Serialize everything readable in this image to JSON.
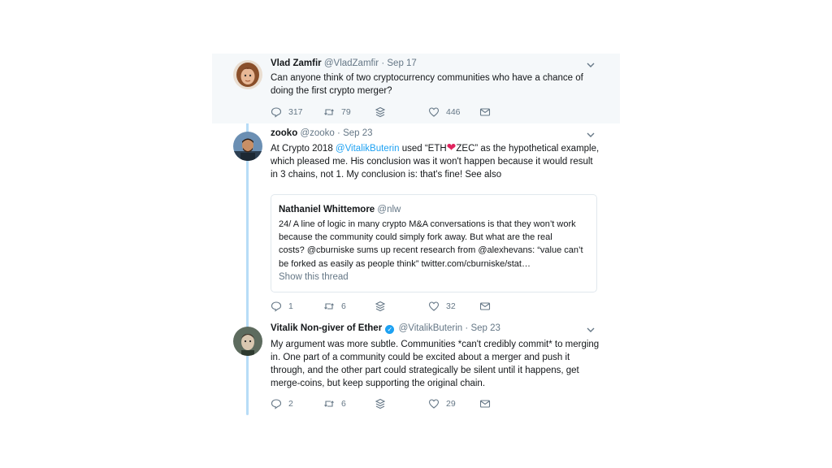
{
  "tweets": [
    {
      "name": "Vlad Zamfir",
      "handle": "@VladZamfir",
      "date": "Sep 17",
      "text_lines": [
        "Can anyone think of two cryptocurrency communities who have a chance of",
        "doing the first crypto merger?"
      ],
      "replies": "317",
      "retweets": "79",
      "likes": "446"
    },
    {
      "name": "zooko",
      "handle": "@zooko",
      "date": "Sep 23",
      "line1_before": "At Crypto 2018 ",
      "line1_mention": "@VitalikButerin",
      "line1_mid": " used “ETH",
      "line1_heart": "❤",
      "line1_after": "ZEC” as the hypothetical example,",
      "line2": "which pleased me. His conclusion was it won't happen because it would result",
      "line3": "in 3 chains, not 1. My conclusion is: that's fine! See also",
      "quote": {
        "name": "Nathaniel Whittemore",
        "handle": "@nlw",
        "lines": [
          "24/ A line of logic in many crypto M&A conversations is that they won’t work",
          "because the community could simply fork away. But what are the real",
          "costs? @cburniske sums up recent research from @alexhevans: “value can’t",
          "be forked as easily as people think” twitter.com/cburniske/stat…"
        ],
        "show_thread": "Show this thread"
      },
      "replies": "1",
      "retweets": "6",
      "likes": "32"
    },
    {
      "name": "Vitalik Non-giver of Ether",
      "verified_icon": "✓",
      "handle": "@VitalikButerin",
      "date": "Sep 23",
      "text_lines": [
        "My argument was more subtle. Communities *can't credibly commit* to merging",
        "in. One part of a community could be excited about a merger and push it",
        "through, and the other part could strategically be silent until it happens, get",
        "merge-coins, but keep supporting the original chain."
      ],
      "replies": "2",
      "retweets": "6",
      "likes": "29"
    }
  ],
  "separator": "·",
  "icons": [
    "chevron-down-icon",
    "reply-icon",
    "retweet-icon",
    "stack-icon",
    "heart-icon",
    "message-icon",
    "verified-icon"
  ],
  "colors": {
    "accent": "#1da1f2",
    "muted": "#657786",
    "thread_line": "#b7dcf7",
    "highlight_bg": "#f5f8fa",
    "heart": "#e0245e"
  }
}
